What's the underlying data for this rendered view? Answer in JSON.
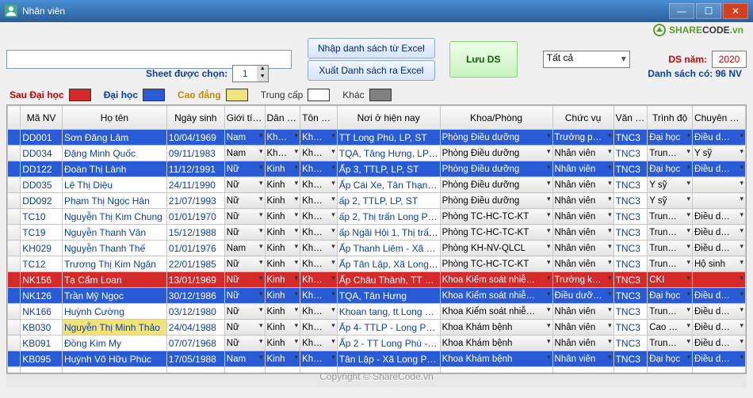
{
  "window": {
    "title": "Nhân viên"
  },
  "watermark": {
    "brand1": "SHARE",
    "brand2": "CODE",
    "tld": ".vn"
  },
  "toolbar": {
    "import_label": "Nhập danh sách từ Excel",
    "export_label": "Xuất Danh sách ra Excel",
    "save_label": "Lưu DS",
    "sheet_label": "Sheet được chọn:",
    "sheet_value": "1",
    "filter_value": "Tất cả",
    "year_label": "DS năm:",
    "year_value": "2020",
    "count_label": "Danh sách có: 96 NV"
  },
  "legend": {
    "sau_dh": {
      "label": "Sau Đại học",
      "color": "#d42a2a"
    },
    "dh": {
      "label": "Đại học",
      "color": "#2a5bd7"
    },
    "cd": {
      "label": "Cao đẳng",
      "color": "#f2e27a"
    },
    "tc": {
      "label": "Trung cấp",
      "color": "#ffffff"
    },
    "khac": {
      "label": "Khác",
      "color": "#808080"
    }
  },
  "columns": [
    "Mã NV",
    "Họ tên",
    "Ngày sinh",
    "Giới tính",
    "Dân tộc",
    "Tôn giáo",
    "Nơi ở hiện nay",
    "Khoa/Phòng",
    "Chức vụ",
    "Văn hóa",
    "Trình độ",
    "Chuyên m…"
  ],
  "rows": [
    {
      "hl": "blue",
      "ma": "DD001",
      "ten": "Sơn Đăng Lâm",
      "ns": "10/04/1969",
      "gt": "Nam",
      "dt": "Kh…",
      "tg": "Không",
      "noi": "TT Long Phú, LP, ST",
      "kp": "Phòng Điều dưỡng",
      "cv": "Trưởng ph…",
      "vh": "TNC3",
      "td": "Đại học",
      "cm": "Điều dưỡ…"
    },
    {
      "hl": "",
      "ma": "DD034",
      "ten": "Đặng Minh Quốc",
      "ns": "09/11/1983",
      "gt": "Nam",
      "dt": "Kh…",
      "tg": "Không",
      "noi": "TQA, Tăng Hưng, LP…",
      "kp": "Phòng Điều dưỡng",
      "cv": "Nhân viên",
      "vh": "TNC3",
      "td": "Trung…",
      "cm": "Y sỹ"
    },
    {
      "hl": "blue",
      "ma": "DD122",
      "ten": "Đoàn Thị Lành",
      "ns": "11/12/1991",
      "gt": "Nữ",
      "dt": "Kinh",
      "tg": "Không",
      "noi": "Ấp 3, TTLP, LP, ST",
      "kp": "Phòng Điều dưỡng",
      "cv": "Nhân viên",
      "vh": "TNC3",
      "td": "Đại học",
      "cm": "Điều dưỡ…"
    },
    {
      "hl": "",
      "ma": "DD035",
      "ten": "Lê Thị Diệu",
      "ns": "24/11/1990",
      "gt": "Nữ",
      "dt": "Kinh",
      "tg": "Không",
      "noi": "Ấp Cái Xe, Tân Thạn…",
      "kp": "Phòng Điều dưỡng",
      "cv": "Nhân viên",
      "vh": "TNC3",
      "td": "Y sỹ",
      "cm": ""
    },
    {
      "hl": "",
      "ma": "DD092",
      "ten": "Phạm Thị Ngọc Hân",
      "ns": "21/07/1993",
      "gt": "Nữ",
      "dt": "Kinh",
      "tg": "Không",
      "noi": "ấp 2, TTLP, LP, ST",
      "kp": "Phòng Điều dưỡng",
      "cv": "Nhân viên",
      "vh": "TNC3",
      "td": "Y sỹ",
      "cm": ""
    },
    {
      "hl": "",
      "ma": "TC10",
      "ten": "Nguyễn Thị Kim Chung",
      "ns": "01/01/1970",
      "gt": "Nữ",
      "dt": "Kinh",
      "tg": "Không",
      "noi": "ấp 2, Thị trấn Long P…",
      "kp": "Phòng TC-HC-TC-KT",
      "cv": "Nhân viên",
      "vh": "TNC3",
      "td": "Trung…",
      "cm": "Điều dưỡ…"
    },
    {
      "hl": "",
      "ma": "TC19",
      "ten": "Nguyễn Thanh Vân",
      "ns": "15/12/1988",
      "gt": "Nữ",
      "dt": "Kinh",
      "tg": "Không",
      "noi": "ấp Ngãi Hội 1, Thị trấ…",
      "kp": "Phòng TC-HC-TC-KT",
      "cv": "Nhân viên",
      "vh": "TNC3",
      "td": "Trung…",
      "cm": "Điều dưỡ…"
    },
    {
      "hl": "",
      "ma": "KH029",
      "ten": "Nguyễn Thanh Thế",
      "ns": "01/01/1976",
      "gt": "Nam",
      "dt": "Kinh",
      "tg": "Không",
      "noi": "Ấp Thanh Liêm - Xã …",
      "kp": "Phòng KH-NV-QLCL",
      "cv": "Nhân viên",
      "vh": "TNC3",
      "td": "Trung…",
      "cm": "Điều dưỡ…"
    },
    {
      "hl": "",
      "ma": "TC12",
      "ten": "Trương Thị Kim Ngân",
      "ns": "22/01/1985",
      "gt": "Nữ",
      "dt": "Kinh",
      "tg": "Không",
      "noi": "Ấp Tân Lập, Xã Long…",
      "kp": "Phòng TC-HC-TC-KT",
      "cv": "Nhân viên",
      "vh": "TNC3",
      "td": "Trung…",
      "cm": "Hộ sinh"
    },
    {
      "hl": "red",
      "ma": "NK156",
      "ten": "Tạ Cẩm Loan",
      "ns": "13/01/1969",
      "gt": "Nữ",
      "dt": "Kinh",
      "tg": "Không",
      "noi": "Ấp Châu Thành, TT L…",
      "kp": "Khoa Kiểm soát nhiễm kh…",
      "cv": "Trưởng khoa",
      "vh": "TNC3",
      "td": "CKI",
      "cm": ""
    },
    {
      "hl": "blue",
      "ma": "NK126",
      "ten": "Trần Mỹ Ngọc",
      "ns": "30/12/1986",
      "gt": "Nữ",
      "dt": "Kinh",
      "tg": "Không",
      "noi": "TQA, Tân Hưng",
      "kp": "Khoa Kiểm soát nhiễm kh…",
      "cv": "Điều dưỡn…",
      "vh": "TNC3",
      "td": "Đại học",
      "cm": "Điều dưỡ…"
    },
    {
      "hl": "",
      "ma": "NK166",
      "ten": "Huỳnh Cường",
      "ns": "03/12/1980",
      "gt": "Nữ",
      "dt": "Kinh",
      "tg": "Không",
      "noi": "Khoan tang, tt Long …",
      "kp": "Khoa Kiểm soát nhiễm kh…",
      "cv": "Nhân viên",
      "vh": "TNC3",
      "td": "Trung…",
      "cm": "Điều dưỡ…"
    },
    {
      "hl": "",
      "hl2": "yellow",
      "ma": "KB030",
      "ten": "Nguyễn Thị Minh Thảo",
      "ns": "24/04/1988",
      "gt": "Nữ",
      "dt": "Kinh",
      "tg": "Không",
      "noi": "Ấp 4- TTLP - Long P…",
      "kp": "Khoa Khám bệnh",
      "cv": "Nhân viên",
      "vh": "TNC3",
      "td": "Cao đ…",
      "cm": "Điều dưỡ…"
    },
    {
      "hl": "",
      "ma": "KB091",
      "ten": "Đồng Kim My",
      "ns": "07/07/1968",
      "gt": "Nữ",
      "dt": "Kinh",
      "tg": "Không",
      "noi": "Ấp 2 - TT Long Phú -…",
      "kp": "Khoa Khám bệnh",
      "cv": "Nhân viên",
      "vh": "TNC3",
      "td": "Trung…",
      "cm": "Điều dưỡ…"
    },
    {
      "hl": "blue",
      "ma": "KB095",
      "ten": "Huỳnh Võ Hữu Phúc",
      "ns": "17/05/1988",
      "gt": "Nam",
      "dt": "Kinh",
      "tg": "Không",
      "noi": "Tân Lập - Xã Long P…",
      "kp": "Khoa Khám bệnh",
      "cv": "Nhân viên",
      "vh": "TNC3",
      "td": "Đại học",
      "cm": "Điều dưỡ…"
    }
  ],
  "footer": {
    "copyright": "Copyright © ShareCode.vn"
  }
}
